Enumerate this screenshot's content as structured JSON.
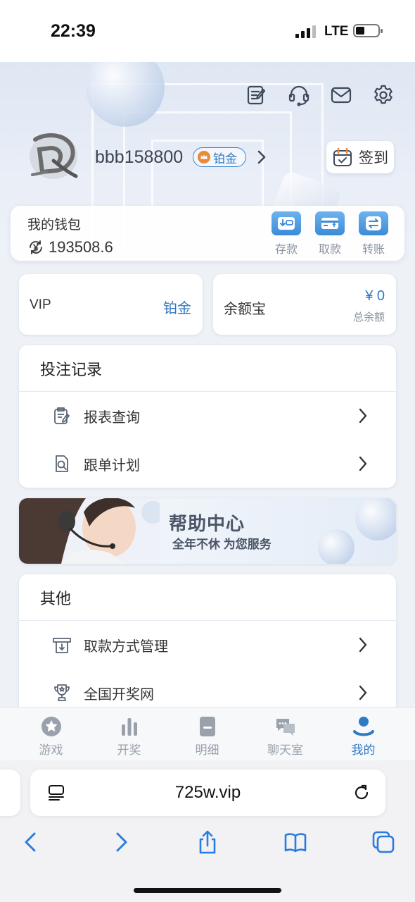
{
  "status_bar": {
    "time": "22:39",
    "network": "LTE"
  },
  "header": {
    "username": "bbb158800",
    "level_badge": "铂金",
    "signin_label": "签到",
    "icons": [
      "edit-icon",
      "headset-icon",
      "mail-icon",
      "gear-icon"
    ]
  },
  "wallet": {
    "title": "我的钱包",
    "balance": "193508.6",
    "actions": [
      {
        "label": "存款",
        "icon": "deposit-icon"
      },
      {
        "label": "取款",
        "icon": "withdraw-icon"
      },
      {
        "label": "转账",
        "icon": "transfer-icon"
      }
    ]
  },
  "vip": {
    "label": "VIP",
    "value": "铂金"
  },
  "yuebao": {
    "label": "余额宝",
    "amount": "¥ 0",
    "sub_label": "总余额"
  },
  "bet_records": {
    "title": "投注记录",
    "items": [
      {
        "label": "报表查询",
        "icon": "report-icon"
      },
      {
        "label": "跟单计划",
        "icon": "search-doc-icon"
      }
    ]
  },
  "banner": {
    "title": "帮助中心",
    "subtitle": "全年不休 为您服务"
  },
  "other": {
    "title": "其他",
    "items": [
      {
        "label": "取款方式管理",
        "icon": "withdraw-method-icon"
      },
      {
        "label": "全国开奖网",
        "icon": "trophy-icon"
      }
    ]
  },
  "tabbar": {
    "active": "我的",
    "tabs": [
      {
        "label": "游戏",
        "icon": "star-icon"
      },
      {
        "label": "开奖",
        "icon": "bar-chart-icon"
      },
      {
        "label": "明细",
        "icon": "document-icon"
      },
      {
        "label": "聊天室",
        "icon": "chat-icon"
      },
      {
        "label": "我的",
        "icon": "user-icon"
      }
    ]
  },
  "browser": {
    "url": "725w.vip"
  },
  "colors": {
    "accent": "#2f7ac2",
    "wallet_button": "#3b8bd8",
    "badge_orange": "#e98a3b"
  }
}
